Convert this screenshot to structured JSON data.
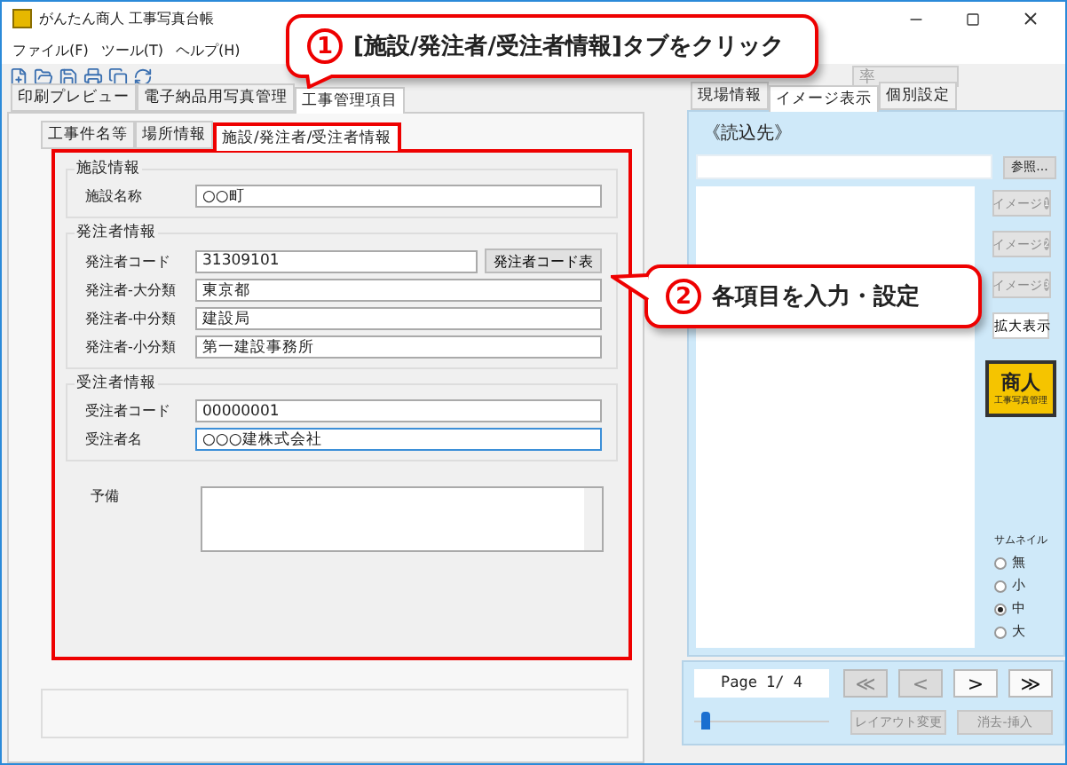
{
  "window": {
    "title": "がんたん商人 工事写真台帳"
  },
  "menu": [
    "ファイル(F)",
    "ツール(T)",
    "ヘルプ(H)"
  ],
  "toolbar": {
    "combo": "率"
  },
  "main_tabs": [
    {
      "label": "印刷プレビュー",
      "selected": false
    },
    {
      "label": "電子納品用写真管理",
      "selected": false
    },
    {
      "label": "工事管理項目",
      "selected": true
    }
  ],
  "inner_tabs": [
    {
      "label": "工事件名等",
      "selected": false
    },
    {
      "label": "場所情報",
      "selected": false
    },
    {
      "label": "施設/発注者/受注者情報",
      "selected": true
    }
  ],
  "form": {
    "groups": [
      {
        "title": "施設情報",
        "fields": [
          {
            "label": "施設名称",
            "value": "○○町",
            "focused": false
          }
        ]
      },
      {
        "title": "発注者情報",
        "fields": [
          {
            "label": "発注者コード",
            "value": "31309101",
            "button": "発注者コード表",
            "focused": false
          },
          {
            "label": "発注者-大分類",
            "value": "東京都",
            "focused": false
          },
          {
            "label": "発注者-中分類",
            "value": "建設局",
            "focused": false
          },
          {
            "label": "発注者-小分類",
            "value": "第一建設事務所",
            "focused": false
          }
        ]
      },
      {
        "title": "受注者情報",
        "fields": [
          {
            "label": "受注者コード",
            "value": "00000001",
            "focused": false
          },
          {
            "label": "受注者名",
            "value": "○○○建株式会社",
            "focused": true
          }
        ]
      }
    ],
    "memo": {
      "label": "予備"
    }
  },
  "right_tabs": [
    {
      "label": "現場情報",
      "selected": false
    },
    {
      "label": "イメージ表示",
      "selected": true
    },
    {
      "label": "個別設定",
      "selected": false
    }
  ],
  "image_panel": {
    "title": "《読込先》",
    "browse_button": "参照...",
    "image_buttons": [
      {
        "label": "イメージ",
        "number": "1",
        "disabled": true
      },
      {
        "label": "イメージ",
        "number": "2",
        "disabled": true
      },
      {
        "label": "イメージ",
        "number": "3",
        "disabled": true
      }
    ],
    "zoom_button": "拡大表示",
    "logo": {
      "main": "商人",
      "sub": "工事写真管理"
    },
    "thumbnail": {
      "title": "サムネイル",
      "options": [
        {
          "label": "無",
          "selected": false
        },
        {
          "label": "小",
          "selected": false
        },
        {
          "label": "中",
          "selected": true
        },
        {
          "label": "大",
          "selected": false
        }
      ]
    }
  },
  "pager": {
    "page": "Page 1/ 4",
    "nav": [
      {
        "label": "≪",
        "disabled": true
      },
      {
        "label": "<",
        "disabled": true
      },
      {
        "label": ">",
        "disabled": false
      },
      {
        "label": "≫",
        "disabled": false
      }
    ],
    "slider": {
      "level": 0.05
    },
    "buttons": [
      {
        "label": "レイアウト変更",
        "disabled": true
      },
      {
        "label": "消去-挿入",
        "disabled": true
      }
    ]
  },
  "callouts": [
    {
      "number": "1",
      "text": "[施設/発注者/受注者情報]タブをクリック"
    },
    {
      "number": "2",
      "text": "各項目を入力・設定"
    }
  ]
}
